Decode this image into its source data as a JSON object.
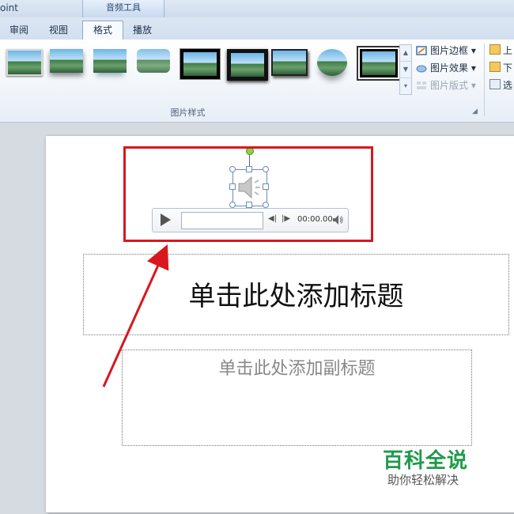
{
  "app_title": "oint",
  "context_group": "音频工具",
  "tabs": [
    {
      "label": "审阅"
    },
    {
      "label": "视图"
    },
    {
      "label": "格式"
    },
    {
      "label": "播放"
    }
  ],
  "ribbon": {
    "picture_styles_label": "图片样式",
    "picture_border": "图片边框",
    "picture_effects": "图片效果",
    "picture_layout": "图片版式",
    "right_partial": [
      "上",
      "下",
      "选"
    ]
  },
  "slide": {
    "title_placeholder": "单击此处添加标题",
    "subtitle_placeholder": "单击此处添加副标题"
  },
  "audio_player": {
    "time": "00:00.00"
  },
  "watermark": {
    "brand": "百科全说",
    "slogan": "助你轻松解决"
  },
  "colors": {
    "annotation_red": "#d9171d",
    "watermark_green": "#1e9b4a"
  }
}
